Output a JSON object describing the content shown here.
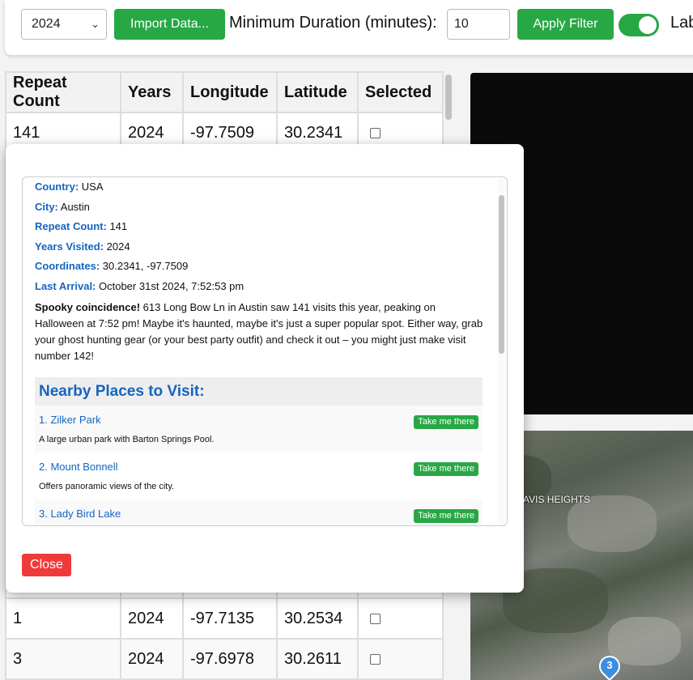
{
  "toolbar": {
    "year_value": "2024",
    "import_label": "Import Data...",
    "duration_label": "Minimum Duration (minutes):",
    "duration_value": "10",
    "apply_label": "Apply Filter",
    "toggle_label": "Lab",
    "toggle_on": true,
    "accent_color": "#28a745"
  },
  "table": {
    "headers": [
      "Repeat Count",
      "Years",
      "Longitude",
      "Latitude",
      "Selected"
    ],
    "rows": [
      {
        "repeat": "141",
        "years": "2024",
        "longitude": "-97.7509",
        "latitude": "30.2341",
        "selected": false
      },
      {
        "repeat": "1",
        "years": "2024",
        "longitude": "-97.7135",
        "latitude": "30.2534",
        "selected": false
      },
      {
        "repeat": "3",
        "years": "2024",
        "longitude": "-97.6978",
        "latitude": "30.2611",
        "selected": false
      }
    ]
  },
  "map": {
    "label": "AVIS HEIGHTS",
    "pin_number": "3"
  },
  "modal": {
    "info": [
      {
        "key": "Country:",
        "value": " USA"
      },
      {
        "key": "City:",
        "value": " Austin"
      },
      {
        "key": "Repeat Count:",
        "value": " 141"
      },
      {
        "key": "Years Visited:",
        "value": " 2024"
      },
      {
        "key": "Coordinates:",
        "value": " 30.2341, -97.7509"
      },
      {
        "key": "Last Arrival:",
        "value": " October 31st 2024, 7:52:53 pm"
      }
    ],
    "description_bold": "Spooky coincidence!",
    "description_text": " 613 Long Bow Ln in Austin saw 141 visits this year, peaking on Halloween at 7:52 pm! Maybe it's haunted, maybe it's just a super popular spot. Either way, grab your ghost hunting gear (or your best party outfit) and check it out – you might just make visit number 142!",
    "nearby_title": "Nearby Places to Visit:",
    "places": [
      {
        "name": "1. Zilker Park",
        "desc": "A large urban park with Barton Springs Pool.",
        "button": "Take me there"
      },
      {
        "name": "2. Mount Bonnell",
        "desc": "Offers panoramic views of the city.",
        "button": "Take me there"
      },
      {
        "name": "3. Lady Bird Lake",
        "desc": "",
        "button": "Take me there"
      }
    ],
    "close_label": "Close",
    "link_color": "#1565c0",
    "close_color": "#f03a3a"
  }
}
